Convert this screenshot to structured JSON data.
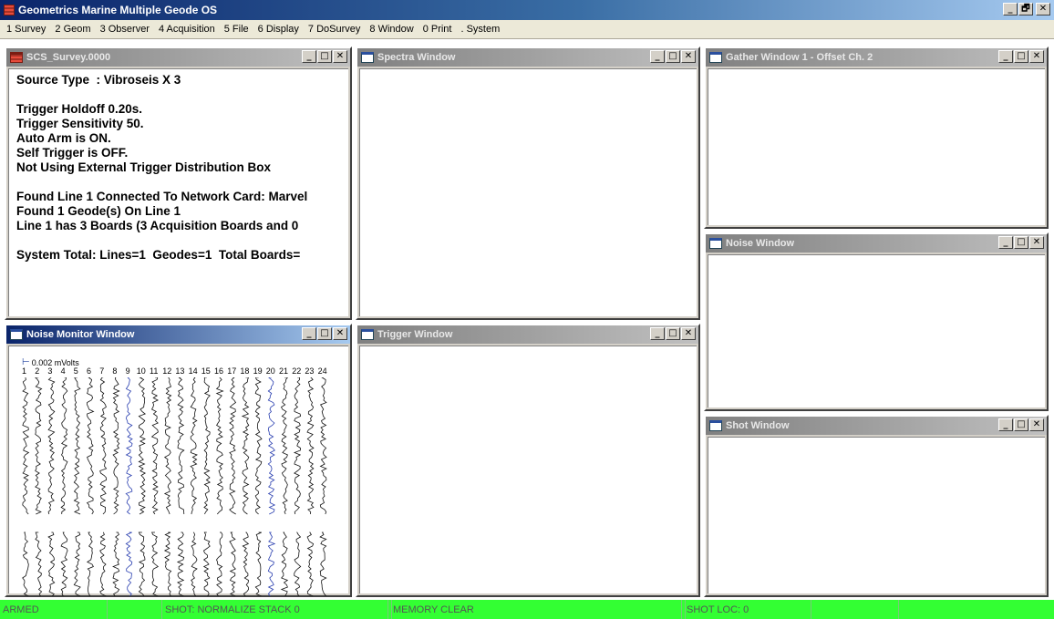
{
  "app": {
    "title": "Geometrics Marine Multiple Geode OS",
    "caption_buttons": [
      "_",
      "🗗",
      "✕"
    ]
  },
  "menu": [
    {
      "label": "1 Survey"
    },
    {
      "label": "2 Geom"
    },
    {
      "label": "3 Observer"
    },
    {
      "label": "4 Acquisition"
    },
    {
      "label": "5 File"
    },
    {
      "label": "6 Display"
    },
    {
      "label": "7 DoSurvey"
    },
    {
      "label": "8 Window"
    },
    {
      "label": "0 Print"
    },
    {
      "label": ". System"
    }
  ],
  "windows": {
    "survey": {
      "title": "SCS_Survey.0000",
      "lines": [
        "Source Type  : Vibroseis X 3",
        "",
        "Trigger Holdoff 0.20s.",
        "Trigger Sensitivity 50.",
        "Auto Arm is ON.",
        "Self Trigger is OFF.",
        "Not Using External Trigger Distribution Box",
        "",
        "Found Line 1 Connected To Network Card: Marvel",
        "Found 1 Geode(s) On Line 1",
        "Line 1 has 3 Boards (3 Acquisition Boards and 0",
        "",
        "System Total: Lines=1  Geodes=1  Total Boards="
      ]
    },
    "spectra": {
      "title": "Spectra Window"
    },
    "gather": {
      "title": "Gather Window 1 - Offset Ch. 2"
    },
    "noise": {
      "title": "Noise Window"
    },
    "noise_monitor": {
      "title": "Noise Monitor Window",
      "scale": "0.002 mVolts",
      "channels": [
        "1",
        "2",
        "3",
        "4",
        "5",
        "6",
        "7",
        "8",
        "9",
        "10",
        "11",
        "12",
        "13",
        "14",
        "15",
        "16",
        "17",
        "18",
        "19",
        "20",
        "21",
        "22",
        "23",
        "24"
      ],
      "highlight_color": "#2a3fb0",
      "trace_color": "#111111"
    },
    "trigger": {
      "title": "Trigger Window"
    },
    "shot": {
      "title": "Shot Window"
    },
    "control_buttons": [
      "_",
      "□",
      "✕"
    ]
  },
  "status": [
    {
      "text": "ARMED"
    },
    {
      "text": ""
    },
    {
      "text": "SHOT: NORMALIZE  STACK 0"
    },
    {
      "text": ""
    },
    {
      "text": "MEMORY CLEAR"
    },
    {
      "text": ""
    },
    {
      "text": "SHOT LOC: 0"
    },
    {
      "text": ""
    },
    {
      "text": ""
    }
  ],
  "colors": {
    "status_bar": "#33ff33",
    "active_title": "#0a246a",
    "inactive_title": "#808080"
  }
}
